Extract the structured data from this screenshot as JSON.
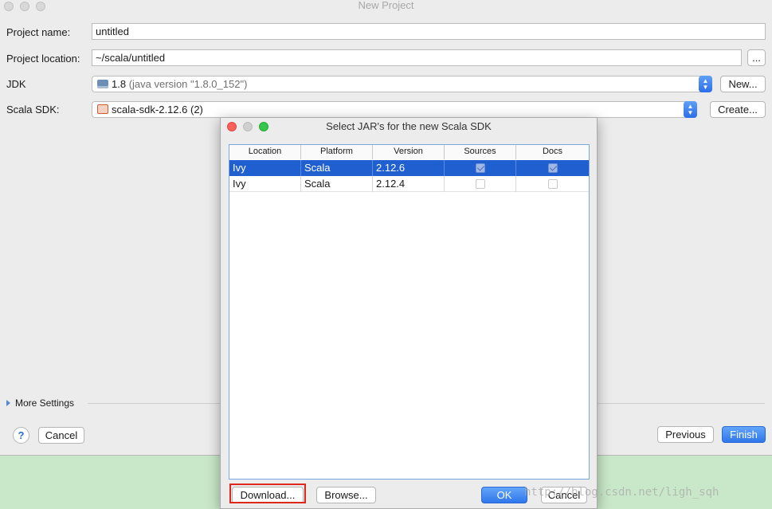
{
  "window": {
    "title": "New Project"
  },
  "form": {
    "project_name_label": "Project name:",
    "project_name_value": "untitled",
    "project_location_label": "Project location:",
    "project_location_value": "~/scala/untitled",
    "browse_label": "...",
    "jdk_label": "JDK",
    "jdk_value": "1.8",
    "jdk_detail": "(java version \"1.8.0_152\")",
    "jdk_new_label": "New...",
    "scala_sdk_label": "Scala SDK:",
    "scala_sdk_value": "scala-sdk-2.12.6 (2)",
    "scala_create_label": "Create..."
  },
  "footer": {
    "more_settings_label": "More Settings",
    "help_label": "?",
    "cancel_label": "Cancel",
    "previous_label": "Previous",
    "finish_label": "Finish"
  },
  "dialog": {
    "title": "Select JAR's for the new Scala SDK",
    "columns": [
      "Location",
      "Platform",
      "Version",
      "Sources",
      "Docs"
    ],
    "rows": [
      {
        "location": "Ivy",
        "platform": "Scala",
        "version": "2.12.6",
        "sources": true,
        "docs": true,
        "selected": true
      },
      {
        "location": "Ivy",
        "platform": "Scala",
        "version": "2.12.4",
        "sources": false,
        "docs": false,
        "selected": false
      }
    ],
    "download_label": "Download...",
    "browse_label": "Browse...",
    "ok_label": "OK",
    "cancel_label": "Cancel"
  },
  "watermark": "http://blog.csdn.net/ligh_sqh",
  "colors": {
    "accent": "#2f77ec",
    "selection": "#1f5fcf",
    "highlight_outline": "#e0271b"
  }
}
